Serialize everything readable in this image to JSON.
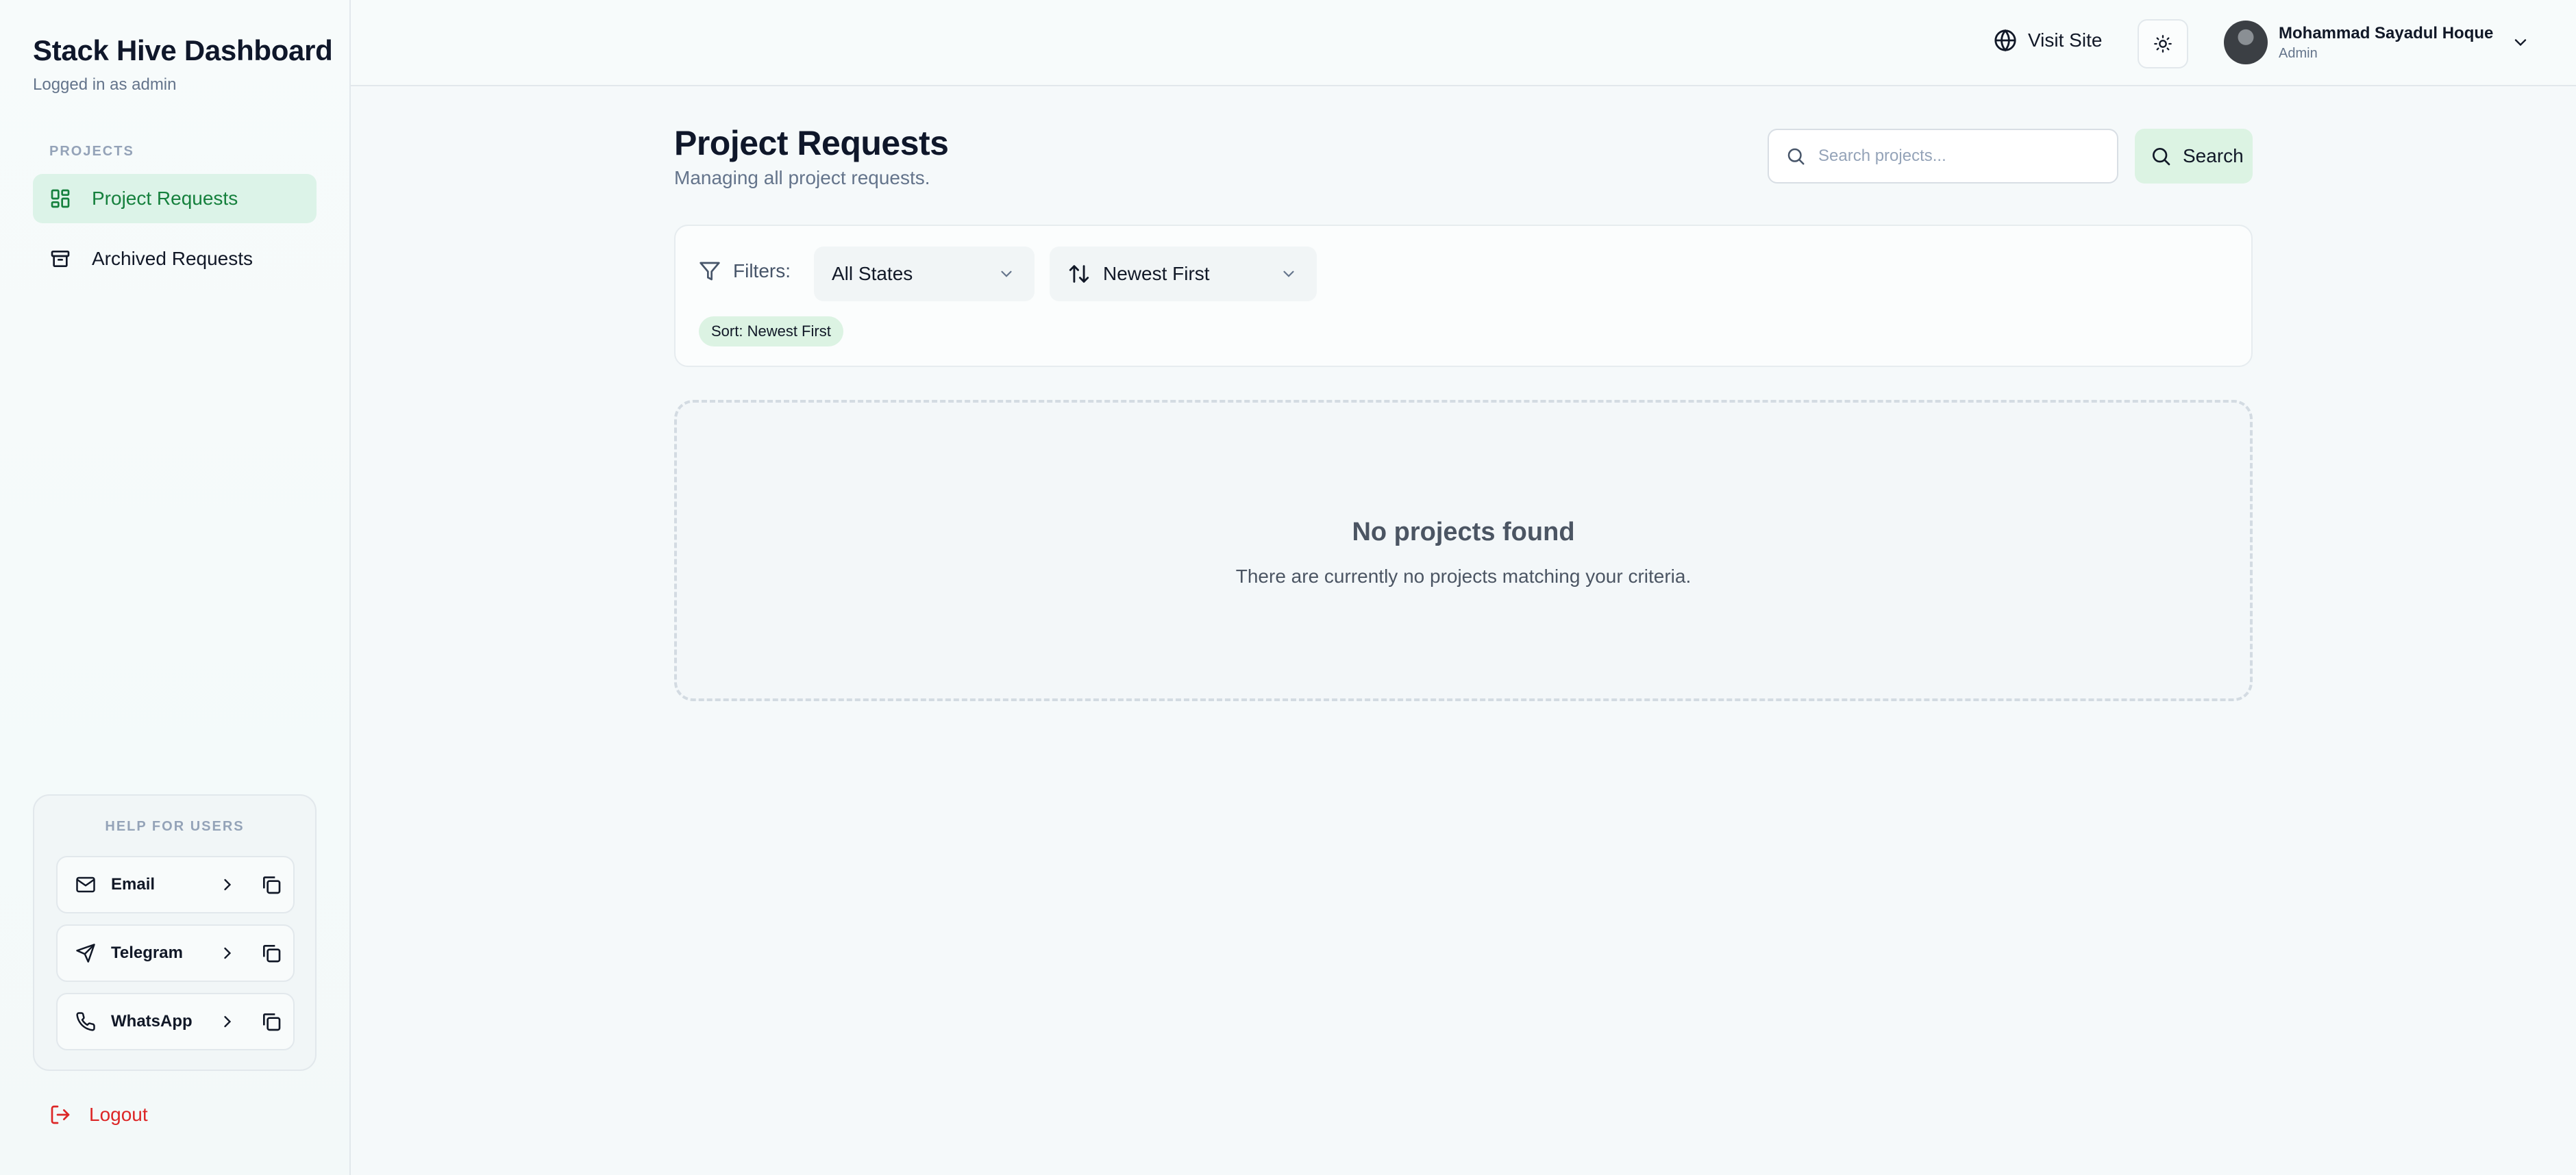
{
  "sidebar": {
    "title": "Stack Hive Dashboard",
    "subtitle": "Logged in as admin",
    "section_label": "PROJECTS",
    "items": [
      {
        "label": "Project Requests",
        "icon": "dashboard-icon",
        "active": true
      },
      {
        "label": "Archived Requests",
        "icon": "archive-icon",
        "active": false
      }
    ],
    "help": {
      "title": "HELP FOR USERS",
      "items": [
        {
          "label": "Email",
          "icon": "mail-icon"
        },
        {
          "label": "Telegram",
          "icon": "send-icon"
        },
        {
          "label": "WhatsApp",
          "icon": "phone-icon"
        }
      ]
    },
    "logout_label": "Logout"
  },
  "header": {
    "visit_site_label": "Visit Site",
    "user": {
      "name": "Mohammad Sayadul Hoque",
      "role": "Admin"
    }
  },
  "main": {
    "title": "Project Requests",
    "subtitle": "Managing all project requests.",
    "search": {
      "placeholder": "Search projects...",
      "value": "",
      "button_label": "Search"
    },
    "filters": {
      "label": "Filters:",
      "state_select": "All States",
      "sort_select": "Newest First",
      "chip": "Sort: Newest First"
    },
    "empty": {
      "title": "No projects found",
      "message": "There are currently no projects matching your criteria."
    }
  },
  "colors": {
    "accent": "#15803d",
    "accent_bg": "#dcf3e8",
    "danger": "#dc2626",
    "background": "#f5f9fa"
  }
}
